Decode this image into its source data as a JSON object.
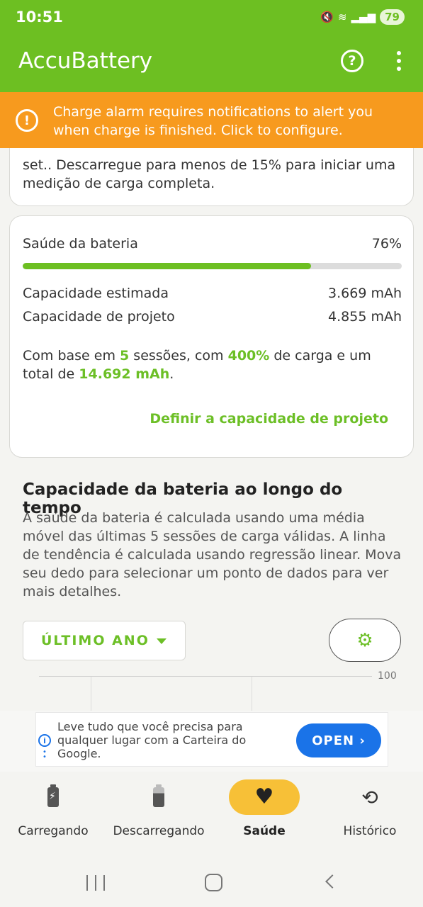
{
  "status_bar": {
    "time": "10:51",
    "battery_level": "79",
    "icons": [
      "mute-icon",
      "wifi-icon",
      "signal-icon"
    ]
  },
  "app_bar": {
    "title": "AccuBattery",
    "help_glyph": "?"
  },
  "alarm_banner": {
    "text": "Charge alarm requires notifications to alert you when charge is finished. Click to configure.",
    "icon": "alert-icon"
  },
  "top_card": {
    "text_line": "set.. Descarregue para menos de 15% para iniciar uma medição de carga completa."
  },
  "health_card": {
    "label": "Saúde da bateria",
    "value": "76%",
    "fraction": 0.76,
    "estimated_label": "Capacidade estimada",
    "estimated_value": "3.669 mAh",
    "design_label": "Capacidade de projeto",
    "design_value": "4.855 mAh",
    "sessions_prefix": "Com base em ",
    "sessions_count": "5",
    "sessions_mid": " sessões, com ",
    "sessions_pct": "400%",
    "sessions_mid2": " de carga e um total de ",
    "sessions_total": "14.692 mAh",
    "sessions_suffix": ".",
    "define_link": "Definir a capacidade de projeto"
  },
  "section": {
    "title": "Capacidade da bateria ao longo do tempo",
    "description": "A saúde da bateria é calculada usando uma média móvel das últimas 5 sessões de carga válidas. A linha de tendência é calculada usando regressão linear. Mova seu dedo para selecionar um ponto de dados para ver mais detalhes.",
    "period": "ÚLTIMO ANO",
    "chart_top_label": "100"
  },
  "ad": {
    "text": "Leve tudo que você precisa para qualquer lugar com a Carteira do Google.",
    "button": "OPEN ›",
    "info_glyph": "i"
  },
  "bottom_nav": {
    "items": [
      {
        "label": "Carregando",
        "icon": "battery-charging-icon"
      },
      {
        "label": "Descarregando",
        "icon": "battery-discharging-icon"
      },
      {
        "label": "Saúde",
        "icon": "heart-icon",
        "active": true
      },
      {
        "label": "Histórico",
        "icon": "history-icon"
      }
    ]
  },
  "colors": {
    "brand_green": "#6dbf22",
    "alarm_orange": "#f79a1e",
    "active_tab": "#f7c037",
    "ad_blue": "#1a73e8"
  }
}
